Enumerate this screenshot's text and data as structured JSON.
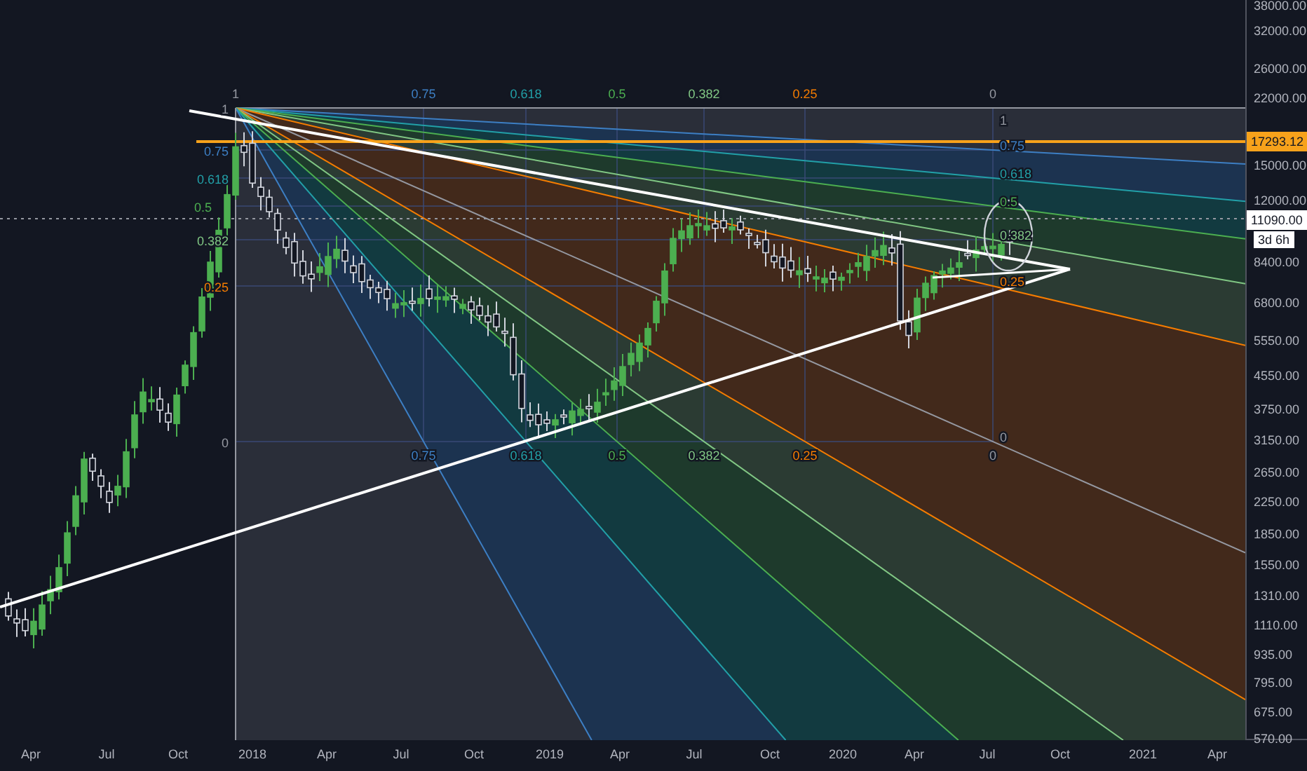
{
  "chart": {
    "fib_fan": {
      "top_labels": [
        "1",
        "0.75",
        "0.618",
        "0.5",
        "0.382",
        "0.25",
        "0"
      ],
      "bottom_labels": [
        "0.75",
        "0.618",
        "0.5",
        "0.382",
        "0.25",
        "0"
      ],
      "left_labels": [
        "1",
        "0.75",
        "0.618",
        "0.5",
        "0.382",
        "0.25",
        "0"
      ],
      "right_labels": [
        "1",
        "0.75",
        "0.618",
        "0.5",
        "0.382",
        "0.25",
        "0"
      ]
    },
    "price_axis": {
      "labels": [
        "38000.00",
        "32000.00",
        "26000.00",
        "22000.00",
        "15000.00",
        "12000.00",
        "8400.00",
        "6800.00",
        "5550.00",
        "4550.00",
        "3750.00",
        "3150.00",
        "2650.00",
        "2250.00",
        "1850.00",
        "1550.00",
        "1310.00",
        "1110.00",
        "935.00",
        "795.00",
        "675.00",
        "570.00"
      ]
    },
    "price_tags": [
      {
        "kind": "high_line",
        "text": "17293.12"
      },
      {
        "kind": "last_price",
        "text": "11090.00"
      },
      {
        "kind": "countdown",
        "text": "3d 6h"
      }
    ],
    "time_axis": {
      "labels": [
        "Apr",
        "Jul",
        "Oct",
        "2018",
        "Apr",
        "Jul",
        "Oct",
        "2019",
        "Apr",
        "Jul",
        "Oct",
        "2020",
        "Apr",
        "Jul",
        "Oct",
        "2021",
        "Apr"
      ]
    }
  }
}
